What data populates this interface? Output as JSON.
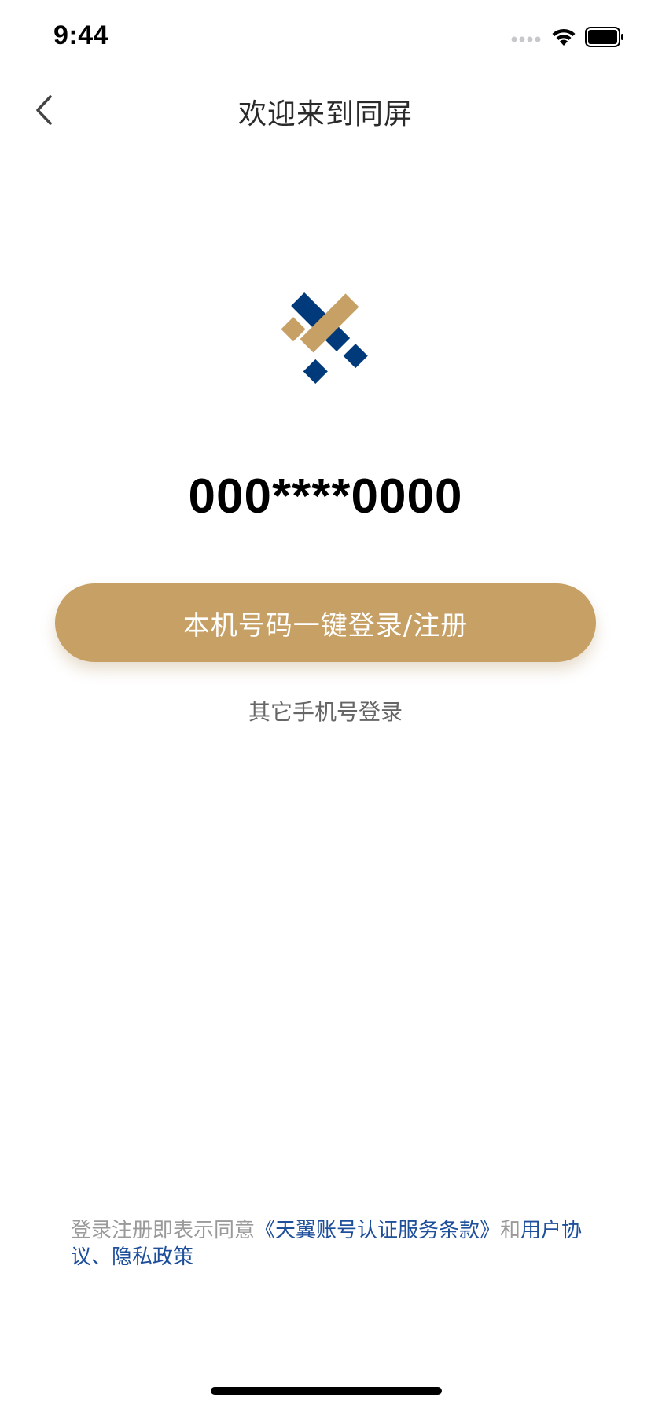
{
  "status_bar": {
    "time": "9:44",
    "icons": [
      "signal-icon",
      "wifi-icon",
      "battery-icon"
    ]
  },
  "nav": {
    "back_icon": "chevron-left-icon",
    "title": "欢迎来到同屏"
  },
  "logo": {
    "icon": "app-logo",
    "colors": {
      "navy": "#003a7a",
      "gold": "#c6a064"
    }
  },
  "phone_number": "000****0000",
  "primary_button": {
    "label": "本机号码一键登录/注册",
    "color": "#c6a064"
  },
  "other_login": "其它手机号登录",
  "agreement": {
    "prefix": "登录注册即表示同意",
    "terms": "《天翼账号认证服务条款》",
    "and": "和",
    "user_agreement": "用户协议",
    "separator": "、",
    "privacy": "隐私政策"
  },
  "colors": {
    "link": "#1e4f9a",
    "muted_text": "#9a9a9a"
  }
}
